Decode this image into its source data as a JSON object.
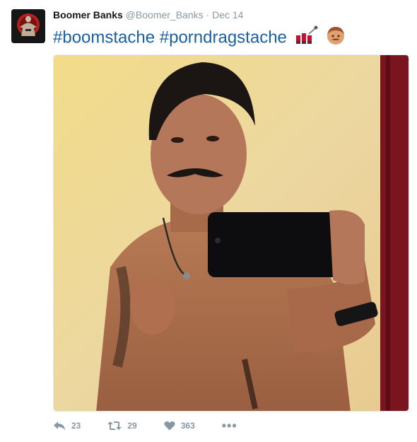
{
  "tweet": {
    "display_name": "Boomer Banks",
    "handle": "@Boomer_Banks",
    "separator": "·",
    "date": "Dec 14",
    "hashtags": [
      "#boomstache",
      "#porndragstache"
    ],
    "emojis": [
      "lipstick-emoji",
      "man-emoji"
    ]
  },
  "actions": {
    "reply_count": "23",
    "retweet_count": "29",
    "like_count": "363",
    "more_label": "•••"
  },
  "icons": [
    "reply-icon",
    "retweet-icon",
    "heart-icon",
    "more-icon"
  ],
  "colors": {
    "hashtag": "#1b5f9e",
    "muted": "#8899a6",
    "name": "#14171a"
  }
}
